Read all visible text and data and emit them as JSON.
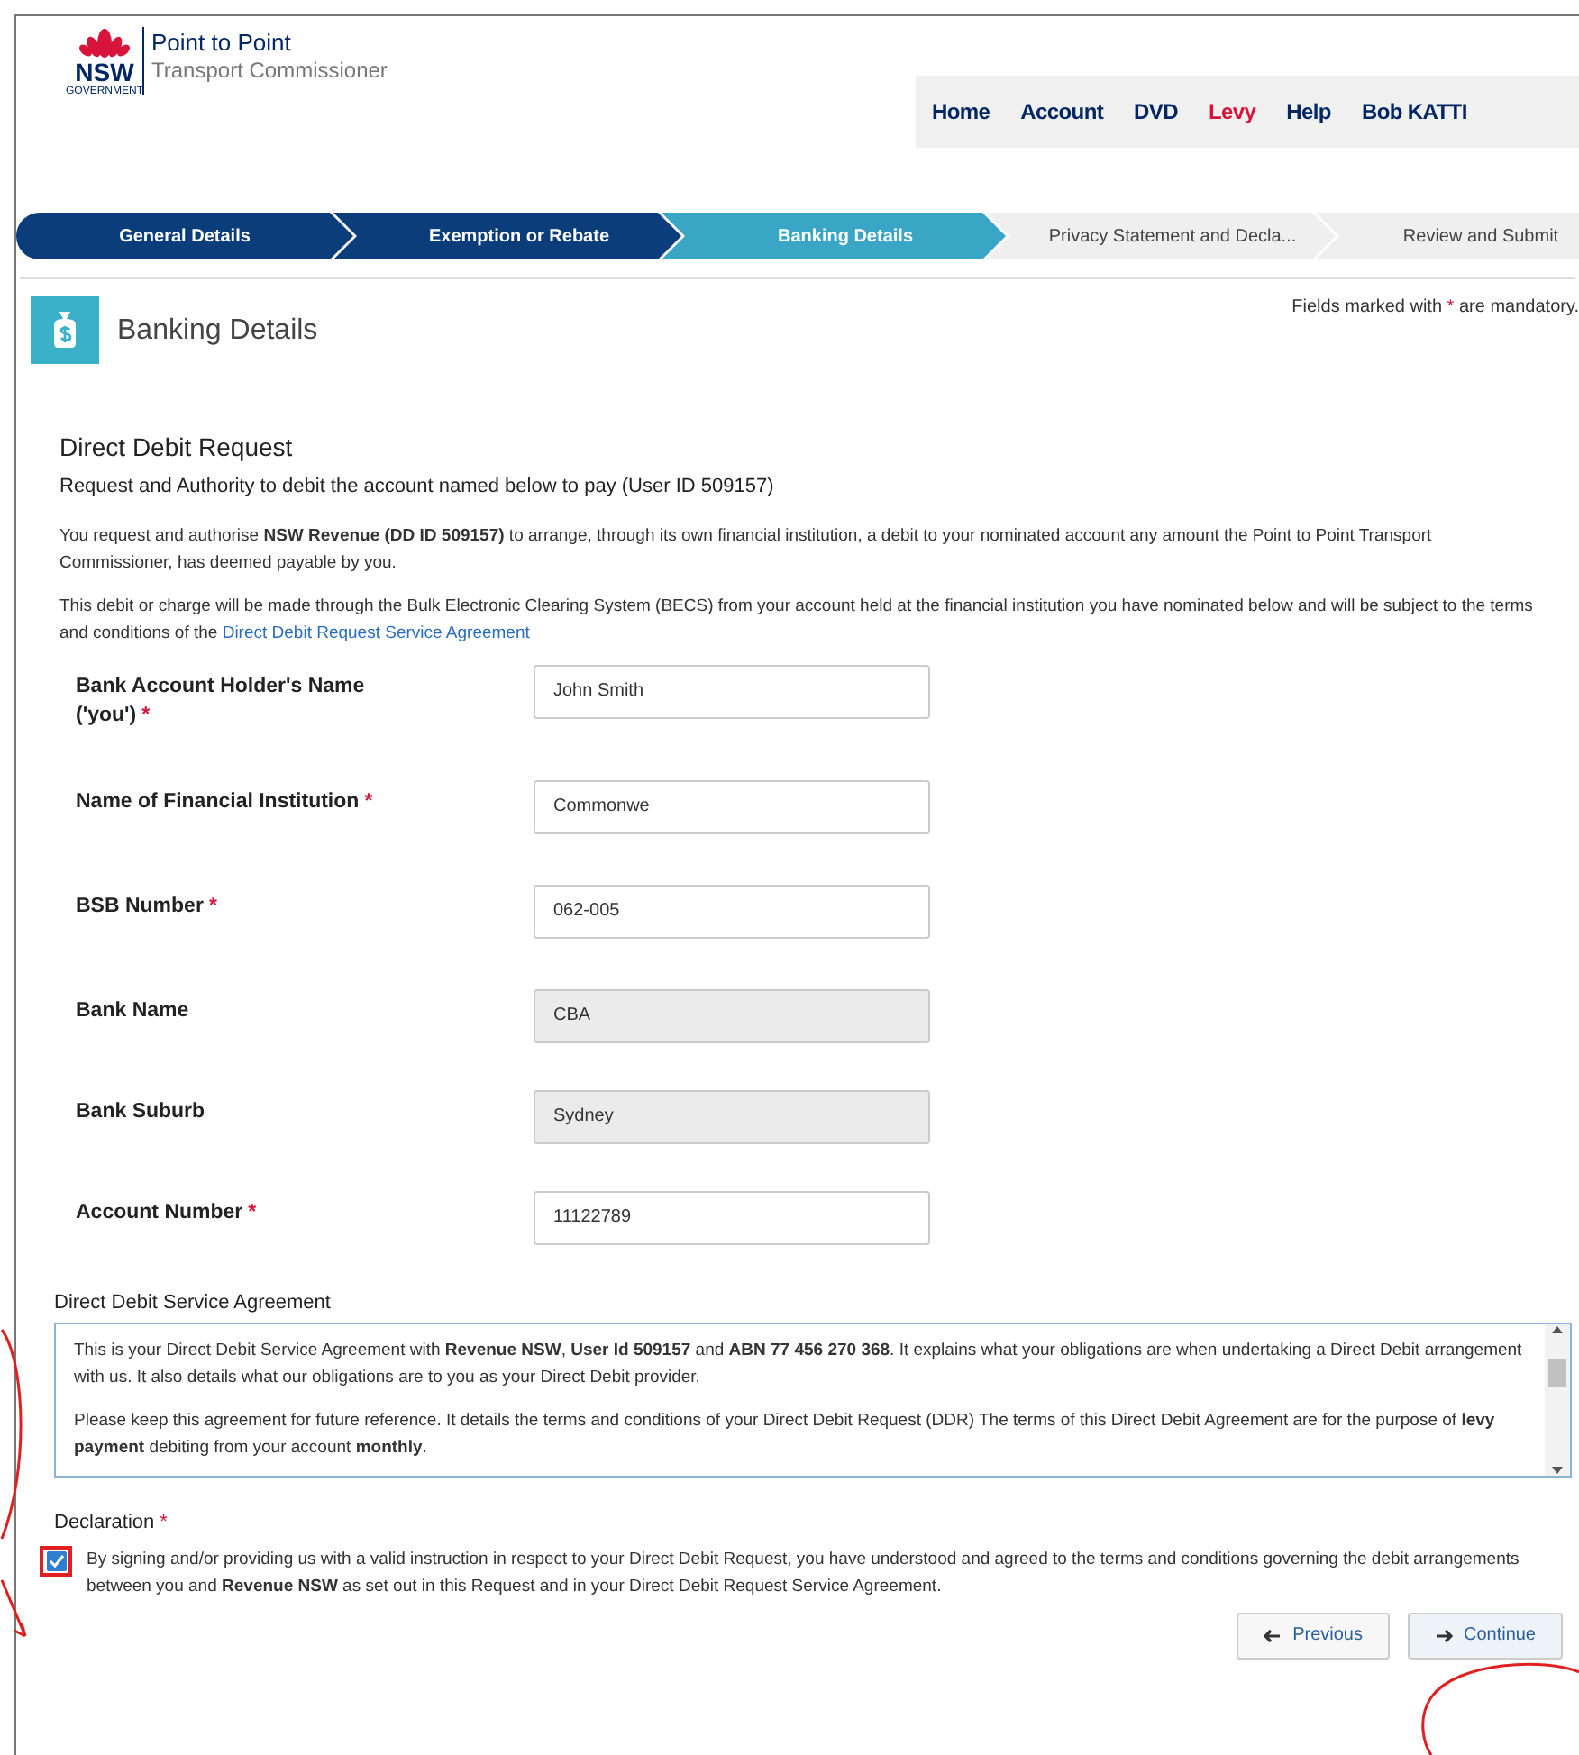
{
  "header": {
    "logo_mark": "NSW",
    "logo_sub": "GOVERNMENT",
    "title": "Point to Point",
    "subtitle": "Transport Commissioner"
  },
  "nav": [
    {
      "label": "Home",
      "selected": false
    },
    {
      "label": "Account",
      "selected": false
    },
    {
      "label": "DVD",
      "selected": false
    },
    {
      "label": "Levy",
      "selected": true
    },
    {
      "label": "Help",
      "selected": false
    },
    {
      "label": "Bob KATTI",
      "selected": false
    }
  ],
  "steps": [
    {
      "label": "General Details",
      "kind": "done"
    },
    {
      "label": "Exemption or Rebate",
      "kind": "done"
    },
    {
      "label": "Banking Details",
      "kind": "current"
    },
    {
      "label": "Privacy Statement and Decla...",
      "kind": "upcoming"
    },
    {
      "label": "Review and Submit",
      "kind": "upcoming"
    }
  ],
  "page_title": "Banking Details",
  "mandatory_note": "Fields marked with ***** are mandatory.",
  "section": {
    "title": "Direct Debit Request",
    "subtitle": "Request and Authority to debit the account named below to pay (User ID 509157)",
    "paragraph_1": "You request and authorise **NSW Revenue (DD ID 509157)** to arrange, through its own financial institution, a debit to your nominated account any amount the Point to Point Transport Commissioner, has deemed payable by you.",
    "paragraph_2": "This debit or charge will be made through the Bulk Electronic Clearing System (BECS) from your account held at the financial institution you have nominated below and will be subject to the terms and conditions of the",
    "link": "Direct Debit Request Service Agreement"
  },
  "fields": [
    {
      "label": "Bank Account Holder's Name ('you')",
      "required_mark": "*",
      "value": "John Smith",
      "disabled": false
    },
    {
      "label": "Name of Financial Institution",
      "required_mark": "*",
      "value": "Commonwe",
      "disabled": false
    },
    {
      "label": "BSB Number",
      "required_mark": "*",
      "value": "062-005",
      "disabled": false
    },
    {
      "label": "Bank Name",
      "value": "CBA",
      "disabled": true
    },
    {
      "label": "Bank Suburb",
      "value": "Sydney",
      "disabled": true
    },
    {
      "label": "Account Number",
      "required_mark": "*",
      "value": "11122789",
      "disabled": false
    }
  ],
  "agreement": {
    "title": "Direct Debit Service Agreement",
    "paragraphs": [
      "This is your Direct Debit Service Agreement with **Revenue NSW**, **User Id 509157** and **ABN 77 456 270 368**. It explains what your obligations are when undertaking a Direct Debit arrangement with us. It also details what our obligations are to you as your Direct Debit provider.",
      "Please keep this agreement for future reference. It details the terms and conditions of your Direct Debit Request (DDR) The terms of this Direct Debit Agreement are for the purpose of **levy payment** debiting from your account **monthly**."
    ]
  },
  "declaration": {
    "title": "Declaration",
    "required_mark": "*",
    "checked": true,
    "text": "By signing and/or providing us with a valid instruction in respect to your Direct Debit Request, you have understood and agreed to the terms and conditions governing the debit arrangements between you and **Revenue NSW** as set out in this Request and in your Direct Debit Request Service Agreement."
  },
  "buttons": [
    {
      "label": "Previous",
      "kind": "back"
    },
    {
      "label": "Continue",
      "kind": "next"
    }
  ]
}
